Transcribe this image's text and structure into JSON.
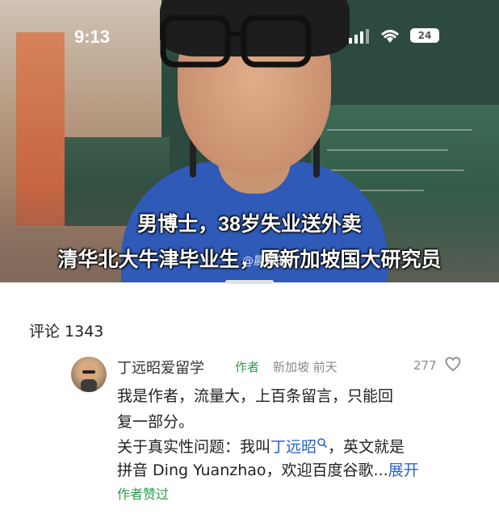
{
  "status_bar": {
    "time": "9:13",
    "battery": "24"
  },
  "video": {
    "caption_line1": "男博士，38岁失业送外卖",
    "caption_line2": "清华北大牛津毕业生，原新加坡国大研究员",
    "watermark": "@晨辉的"
  },
  "comments": {
    "header": "评论 1343",
    "items": [
      {
        "username": "丁远昭爱留学",
        "tag": "作者",
        "location_time": "新加坡 前天",
        "likes": "277",
        "line1": "我是作者，流量大，上百条留言，只能回",
        "line2": "复一部分。",
        "line3_prefix": "关于真实性问题：我叫",
        "line3_link": "丁远昭",
        "line3_suffix": "，英文就是",
        "line4_text": "拼音 Ding Yuanzhao，欢迎百度谷歌...",
        "expand": "展开",
        "author_liked": "作者赞过"
      }
    ]
  },
  "colors": {
    "accent_green": "#2d9b4b",
    "link_blue": "#2a63c8",
    "shirt_blue": "#2f5ab8"
  }
}
